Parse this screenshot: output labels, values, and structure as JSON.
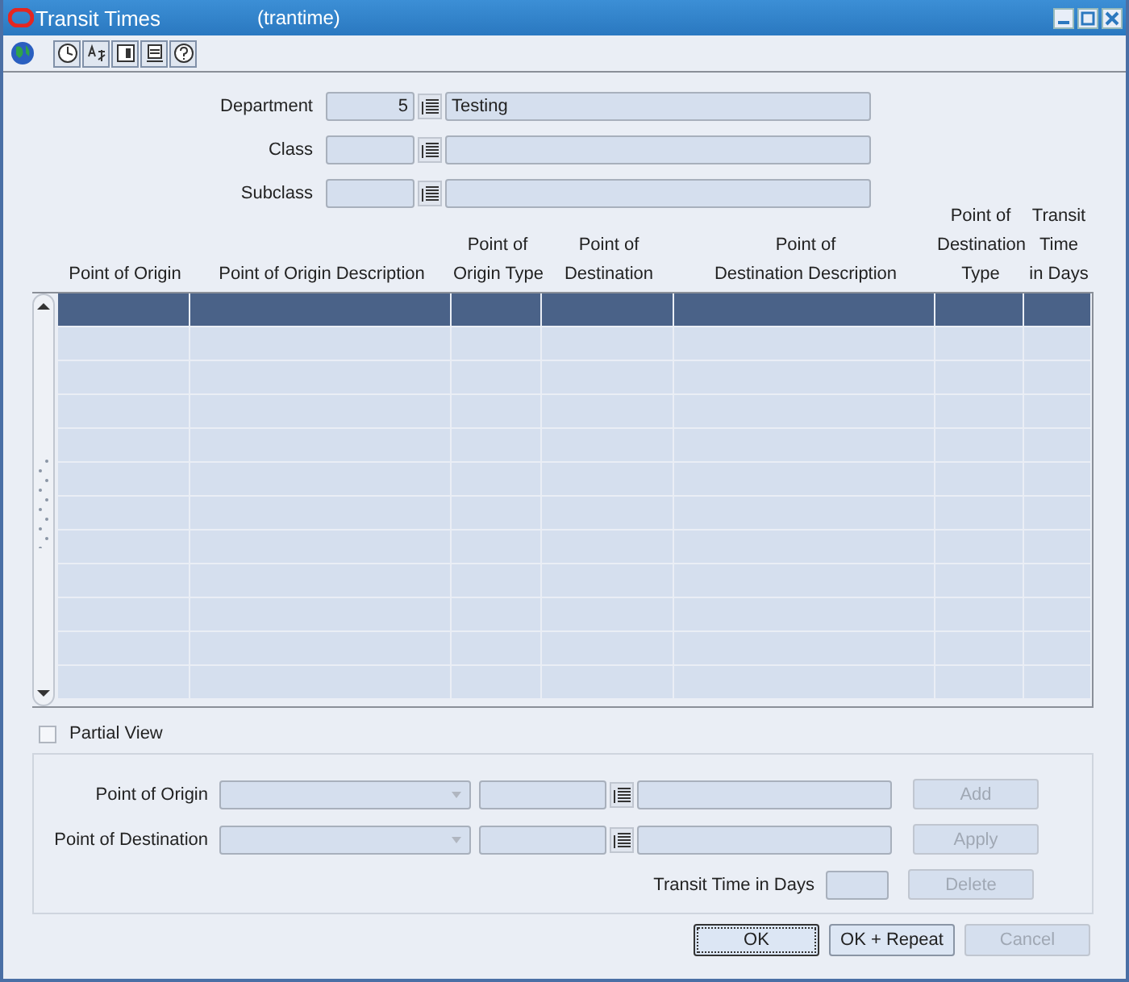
{
  "window": {
    "title": "Transit Times",
    "subtitle": "(trantime)"
  },
  "filters": [
    {
      "label": "Department",
      "code": "5",
      "description": "Testing"
    },
    {
      "label": "Class"
    },
    {
      "label": "Subclass"
    }
  ],
  "table": {
    "columns": [
      "Point of Origin",
      "Point of Origin Description",
      "Point of\nOrigin Type",
      "Point of\nDestination",
      "Point of\nDestination Description",
      "Point of\nDestination\nType",
      "Transit\nTime\nin Days"
    ],
    "rows": [
      {
        "selected": true
      },
      {
        "selected": false
      },
      {
        "selected": false
      },
      {
        "selected": false
      },
      {
        "selected": false
      },
      {
        "selected": false
      },
      {
        "selected": false
      },
      {
        "selected": false
      },
      {
        "selected": false
      },
      {
        "selected": false
      },
      {
        "selected": false
      },
      {
        "selected": false
      }
    ]
  },
  "partial_view": {
    "label": "Partial View",
    "checked": false
  },
  "entry": [
    {
      "label": "Point of Origin",
      "kind": "lookup"
    },
    {
      "label": "Point of Destination",
      "kind": "lookup"
    },
    {
      "label": "Transit Time in Days",
      "kind": "number"
    }
  ],
  "entry_buttons": [
    {
      "label": "Add",
      "disabled": true
    },
    {
      "label": "Apply",
      "disabled": true
    },
    {
      "label": "Delete",
      "disabled": true
    }
  ],
  "buttons": [
    {
      "label": "OK",
      "disabled": false,
      "focused": true
    },
    {
      "label": "OK + Repeat",
      "disabled": false,
      "focused": false
    },
    {
      "label": "Cancel",
      "disabled": true,
      "focused": false
    }
  ]
}
